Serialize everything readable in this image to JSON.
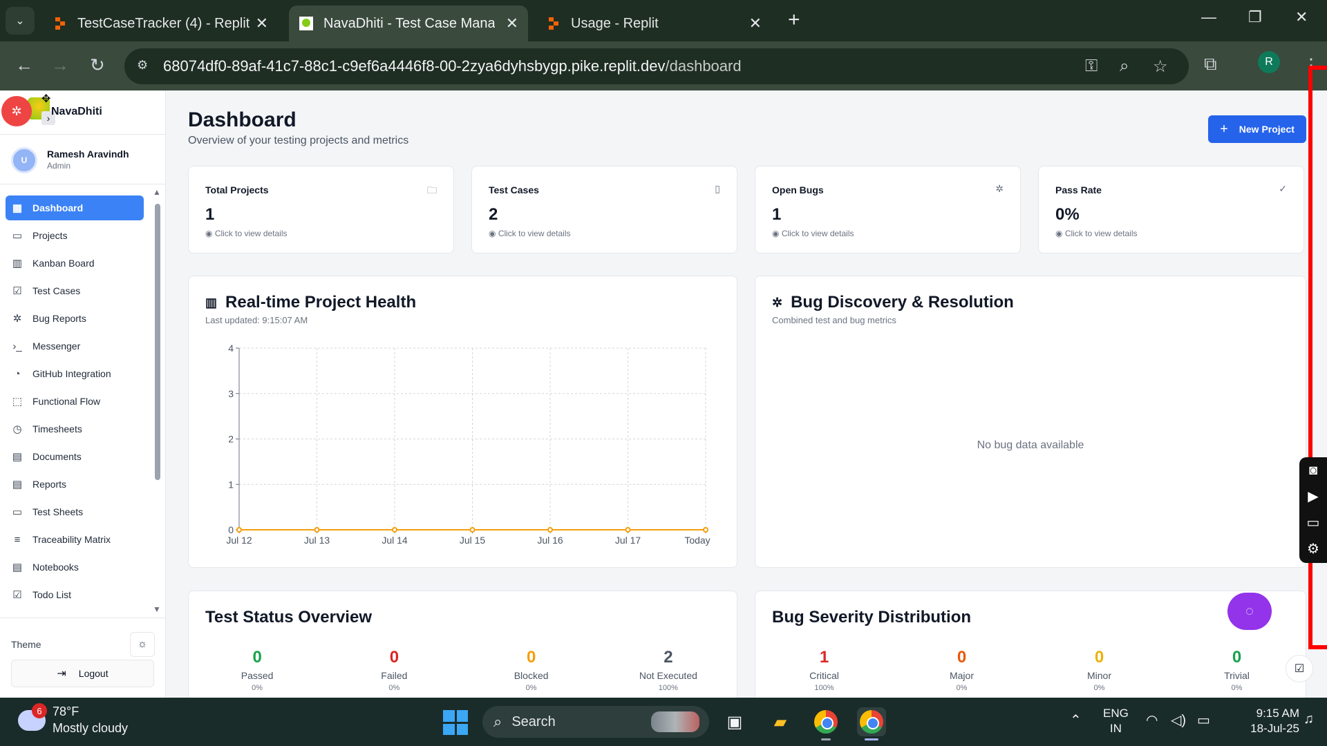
{
  "browser": {
    "tabs": [
      {
        "title": "TestCaseTracker (4) - Replit"
      },
      {
        "title": "NavaDhiti - Test Case Managem"
      },
      {
        "title": "Usage - Replit"
      }
    ],
    "url_host": "68074df0-89af-41c7-88c1-c9ef6a4446f8-00-2zya6dyhsbygp.pike.replit.dev",
    "url_path": "/dashboard",
    "profile_initial": "R"
  },
  "app": {
    "brand": "NavaDhiti",
    "user": {
      "initial": "U",
      "name": "Ramesh Aravindh",
      "role": "Admin"
    },
    "nav": [
      {
        "label": "Dashboard",
        "icon": "grid-icon",
        "glyph": "▦",
        "active": true
      },
      {
        "label": "Projects",
        "icon": "folder-icon",
        "glyph": "▭"
      },
      {
        "label": "Kanban Board",
        "icon": "kanban-icon",
        "glyph": "▥"
      },
      {
        "label": "Test Cases",
        "icon": "check-square-icon",
        "glyph": "☑"
      },
      {
        "label": "Bug Reports",
        "icon": "bug-icon",
        "glyph": "✲"
      },
      {
        "label": "Messenger",
        "icon": "terminal-icon",
        "glyph": "›_"
      },
      {
        "label": "GitHub Integration",
        "icon": "github-icon",
        "glyph": "◔"
      },
      {
        "label": "Functional Flow",
        "icon": "flow-icon",
        "glyph": "⬚"
      },
      {
        "label": "Timesheets",
        "icon": "clock-icon",
        "glyph": "◷"
      },
      {
        "label": "Documents",
        "icon": "document-icon",
        "glyph": "▤"
      },
      {
        "label": "Reports",
        "icon": "report-icon",
        "glyph": "▤"
      },
      {
        "label": "Test Sheets",
        "icon": "sheet-icon",
        "glyph": "▭"
      },
      {
        "label": "Traceability Matrix",
        "icon": "filter-icon",
        "glyph": "≡"
      },
      {
        "label": "Notebooks",
        "icon": "notebook-icon",
        "glyph": "▤"
      },
      {
        "label": "Todo List",
        "icon": "todo-icon",
        "glyph": "☑"
      }
    ],
    "theme_label": "Theme",
    "logout_label": "Logout"
  },
  "dashboard": {
    "title": "Dashboard",
    "subtitle": "Overview of your testing projects and metrics",
    "new_project_label": "New Project",
    "stats": [
      {
        "label": "Total Projects",
        "value": "1",
        "hint": "Click to view details",
        "icon": "folder-icon"
      },
      {
        "label": "Test Cases",
        "value": "2",
        "hint": "Click to view details",
        "icon": "test-tube-icon"
      },
      {
        "label": "Open Bugs",
        "value": "1",
        "hint": "Click to view details",
        "icon": "bug-icon"
      },
      {
        "label": "Pass Rate",
        "value": "0%",
        "hint": "Click to view details",
        "icon": "check-circle-icon"
      }
    ],
    "health": {
      "title": "Real-time Project Health",
      "subtitle": "Last updated: 9:15:07 AM"
    },
    "bug_discovery": {
      "title": "Bug Discovery & Resolution",
      "subtitle": "Combined test and bug metrics",
      "empty": "No bug data available"
    },
    "test_status": {
      "title": "Test Status Overview",
      "items": [
        {
          "value": "0",
          "label": "Passed",
          "pct": "0%",
          "color": "#16a34a"
        },
        {
          "value": "0",
          "label": "Failed",
          "pct": "0%",
          "color": "#dc2626"
        },
        {
          "value": "0",
          "label": "Blocked",
          "pct": "0%",
          "color": "#f59e0b"
        },
        {
          "value": "2",
          "label": "Not Executed",
          "pct": "100%",
          "color": "#4b5563"
        }
      ]
    },
    "bug_severity": {
      "title": "Bug Severity Distribution",
      "items": [
        {
          "value": "1",
          "label": "Critical",
          "pct": "100%",
          "color": "#dc2626"
        },
        {
          "value": "0",
          "label": "Major",
          "pct": "0%",
          "color": "#ea580c"
        },
        {
          "value": "0",
          "label": "Minor",
          "pct": "0%",
          "color": "#eab308"
        },
        {
          "value": "0",
          "label": "Trivial",
          "pct": "0%",
          "color": "#16a34a"
        }
      ]
    }
  },
  "chart_data": {
    "type": "line",
    "x": [
      "Jul 12",
      "Jul 13",
      "Jul 14",
      "Jul 15",
      "Jul 16",
      "Jul 17",
      "Today"
    ],
    "series": [
      {
        "values": [
          0,
          0,
          0,
          0,
          0,
          0,
          0
        ],
        "color": "#f59e0b"
      }
    ],
    "yticks": [
      0,
      1,
      2,
      3,
      4
    ],
    "ylim": [
      0,
      4
    ],
    "grid": true,
    "grid_style": "dashed"
  },
  "taskbar": {
    "weather_badge": "6",
    "temperature": "78°F",
    "condition": "Mostly cloudy",
    "search_label": "Search",
    "lang_top": "ENG",
    "lang_bottom": "IN",
    "time": "9:15 AM",
    "date": "18-Jul-25"
  }
}
